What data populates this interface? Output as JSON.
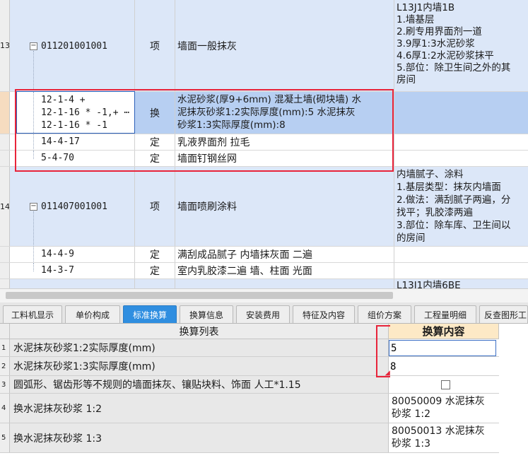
{
  "quota_grid": {
    "rows": [
      {
        "num": "13",
        "code": "011201001001",
        "type": "项",
        "name": "墙面一般抹灰",
        "features": [
          "L13J1内墙1B",
          "1.墙基层",
          "2.刷专用界面剂一道",
          "3.9厚1:3水泥砂浆",
          "4.6厚1:2水泥砂浆抹平",
          "5.部位：除卫生间之外的其",
          "房间"
        ]
      },
      {
        "num": "",
        "code_lines": [
          "12-1-4 +",
          "12-1-16 * -1,+ ⋯",
          "12-1-16 * -1"
        ],
        "type": "换",
        "name_lines": [
          "水泥砂浆(厚9+6mm) 混凝土墙(砌块墙)  水",
          "泥抹灰砂浆1:2实际厚度(mm):5  水泥抹灰",
          "砂浆1:3实际厚度(mm):8"
        ]
      },
      {
        "num": "",
        "code": "14-4-17",
        "type": "定",
        "name": "乳液界面剂 拉毛"
      },
      {
        "num": "",
        "code": "5-4-70",
        "type": "定",
        "name": "墙面钉钢丝网"
      },
      {
        "num": "14",
        "code": "011407001001",
        "type": "项",
        "name": "墙面喷刷涂料",
        "features": [
          "内墙腻子、涂料",
          "1.基层类型：抹灰内墙面",
          "2.做法：满刮腻子两遍，分",
          "找平；乳胶漆两遍",
          "3.部位：除车库、卫生间以",
          "的房间"
        ]
      },
      {
        "num": "",
        "code": "14-4-9",
        "type": "定",
        "name": "满刮成品腻子 内墙抹灰面 二遍"
      },
      {
        "num": "",
        "code": "14-3-7",
        "type": "定",
        "name": "室内乳胶漆二遍 墙、柱面 光面"
      },
      {
        "num": "",
        "features_partial": "L13J1内墙6BE"
      }
    ]
  },
  "tabs": {
    "items": [
      {
        "label": "工料机显示"
      },
      {
        "label": "单价构成"
      },
      {
        "label": "标准换算"
      },
      {
        "label": "换算信息"
      },
      {
        "label": "安装费用"
      },
      {
        "label": "特征及内容"
      },
      {
        "label": "组价方案"
      },
      {
        "label": "工程量明细"
      },
      {
        "label": "反查图形工"
      }
    ],
    "active": "标准换算"
  },
  "conversion": {
    "header_list": "换算列表",
    "header_content": "换算内容",
    "rows": [
      {
        "num": "1",
        "item": "水泥抹灰砂浆1:2实际厚度(mm)",
        "value": "5"
      },
      {
        "num": "2",
        "item": "水泥抹灰砂浆1:3实际厚度(mm)",
        "value": "8"
      },
      {
        "num": "3",
        "item": "圆弧形、锯齿形等不规则的墙面抹灰、镶贴块料、饰面 人工*1.15",
        "value": ""
      },
      {
        "num": "4",
        "item": "换水泥抹灰砂浆 1:2",
        "value_lines": [
          "80050009  水泥抹灰",
          "砂浆 1:2"
        ]
      },
      {
        "num": "5",
        "item": "换水泥抹灰砂浆 1:3",
        "value_lines": [
          "80050013  水泥抹灰",
          "砂浆 1:3"
        ]
      }
    ]
  },
  "colors": {
    "row_blue": "#dce7f8",
    "row_selected": "#b7cff2",
    "tab_active": "#2f8ee0",
    "highlight_red": "#e8243a"
  }
}
